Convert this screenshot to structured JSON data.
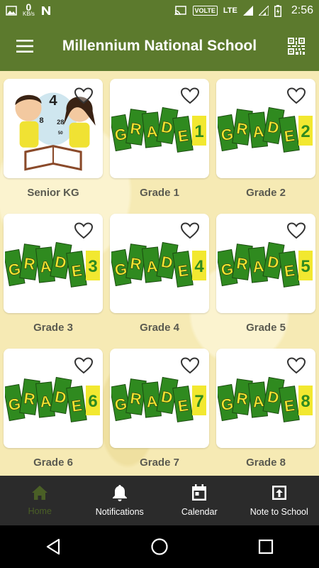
{
  "status_bar": {
    "speed_value": "0",
    "speed_unit": "KB/s",
    "network_badge": "VOLTE",
    "network_type": "LTE",
    "time": "2:56"
  },
  "app_bar": {
    "title": "Millennium National School",
    "menu_icon": "hamburger-menu-icon",
    "action_icon": "qr-code-icon"
  },
  "grades": [
    {
      "label": "Senior KG",
      "number": "",
      "art": "kids-with-book"
    },
    {
      "label": "Grade 1",
      "number": "1",
      "art": "grade-banner"
    },
    {
      "label": "Grade 2",
      "number": "2",
      "art": "grade-banner"
    },
    {
      "label": "Grade 3",
      "number": "3",
      "art": "grade-banner"
    },
    {
      "label": "Grade 4",
      "number": "4",
      "art": "grade-banner"
    },
    {
      "label": "Grade 5",
      "number": "5",
      "art": "grade-banner"
    },
    {
      "label": "Grade 6",
      "number": "6",
      "art": "grade-banner"
    },
    {
      "label": "Grade 7",
      "number": "7",
      "art": "grade-banner"
    },
    {
      "label": "Grade 8",
      "number": "8",
      "art": "grade-banner"
    }
  ],
  "art_text": {
    "grade_word": "GRADE",
    "kg_numbers": [
      "4",
      "8",
      "28",
      "50"
    ]
  },
  "bottom_nav": {
    "items": [
      {
        "label": "Home",
        "icon": "home-icon",
        "active": true
      },
      {
        "label": "Notifications",
        "icon": "bell-icon",
        "active": false
      },
      {
        "label": "Calendar",
        "icon": "calendar-icon",
        "active": false
      },
      {
        "label": "Note to School",
        "icon": "upload-note-icon",
        "active": false
      }
    ]
  },
  "colors": {
    "primary": "#5c7a2d",
    "background": "#f6eab4",
    "nav_bg": "#2b2b2b",
    "nav_active": "#4a5f26",
    "label_text": "#5a5a50",
    "grade_green": "#2f8a1f",
    "grade_yellow": "#f2e830"
  }
}
